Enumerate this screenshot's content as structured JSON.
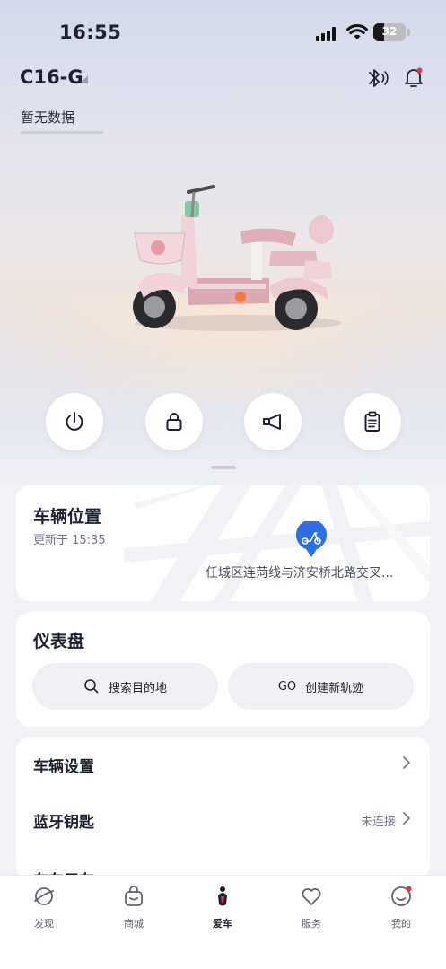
{
  "status": {
    "time": "16:55",
    "battery": "32"
  },
  "header": {
    "vehicle_name": "C16-G",
    "no_data": "暂无数据"
  },
  "controls": [
    {
      "icon": "power-icon"
    },
    {
      "icon": "lock-icon"
    },
    {
      "icon": "horn-icon"
    },
    {
      "icon": "clipboard-icon"
    }
  ],
  "location": {
    "title": "车辆位置",
    "updated": "更新于 15:35",
    "address": "任城区连菏线与济安桥北路交叉..."
  },
  "dashboard": {
    "title": "仪表盘",
    "search_label": "搜索目的地",
    "go_prefix": "GO",
    "track_label": "创建新轨迹"
  },
  "settings": {
    "vehicle_settings": "车辆设置",
    "bt_key": "蓝牙钥匙",
    "bt_status": "未连接",
    "partial_row": "车车用车"
  },
  "tabs": [
    {
      "label": "发现",
      "icon": "planet-icon"
    },
    {
      "label": "商城",
      "icon": "shopping-bag-icon"
    },
    {
      "label": "爱车",
      "icon": "scooter-icon",
      "active": true
    },
    {
      "label": "服务",
      "icon": "heart-icon"
    },
    {
      "label": "我的",
      "icon": "profile-icon"
    }
  ],
  "colors": {
    "accent": "#2f6fe4",
    "alert_dot": "#e8343a",
    "scooter_pink": "#e9c4cc"
  }
}
